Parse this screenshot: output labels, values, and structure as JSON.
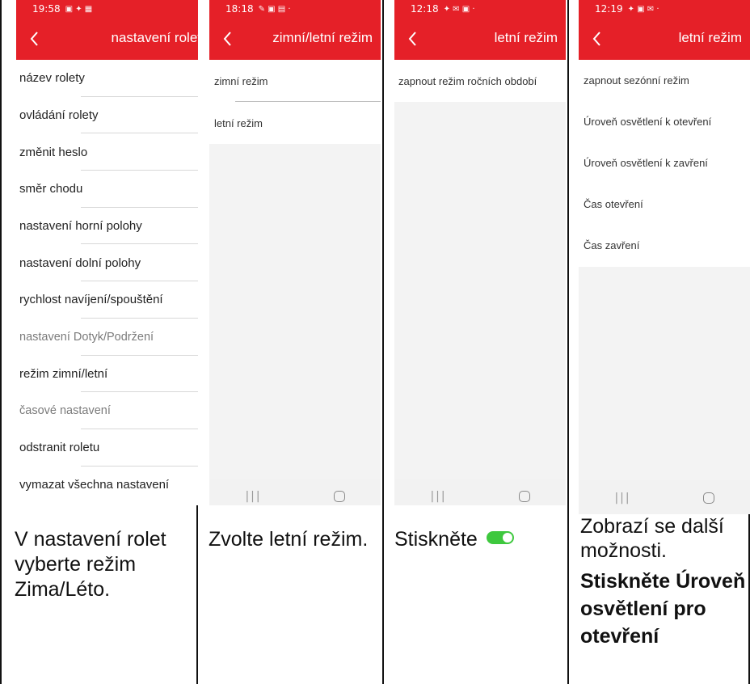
{
  "panel1": {
    "status_time": "19:58",
    "title": "nastavení rolet",
    "items": [
      "název rolety",
      "ovládání rolety",
      "změnit heslo",
      "směr chodu",
      "nastavení horní polohy",
      "nastavení dolní polohy",
      "rychlost navíjení/spouštění",
      "nastavení Dotyk/Podržení",
      "režim zimní/letní",
      "časové nastavení",
      "odstranit roletu",
      "vymazat všechna nastavení"
    ],
    "caption": "V nastavení rolet vyberte režim Zima/Léto."
  },
  "panel2": {
    "status_time": "18:18",
    "title": "zimní/letní režim",
    "items": [
      "zimní režim",
      "letní režim"
    ],
    "caption": "Zvolte letní režim."
  },
  "panel3": {
    "status_time": "12:18",
    "title": "letní režim",
    "items": [
      "zapnout režim ročních období"
    ],
    "caption": "Stiskněte",
    "toggle_color": "#3ec83e"
  },
  "panel4": {
    "status_time": "12:19",
    "title": "letní režim",
    "items": [
      "zapnout sezónní režim",
      "Úroveň osvětlení k otevření",
      "Úroveň osvětlení k zavření",
      "Čas otevření",
      "Čas zavření"
    ],
    "caption_normal": "Zobrazí se další možnosti.",
    "caption_bold": "Stiskněte Úroveň osvětlení pro otevření"
  },
  "nav": {
    "recent": "|||"
  },
  "colors": {
    "accent": "#e52028"
  }
}
